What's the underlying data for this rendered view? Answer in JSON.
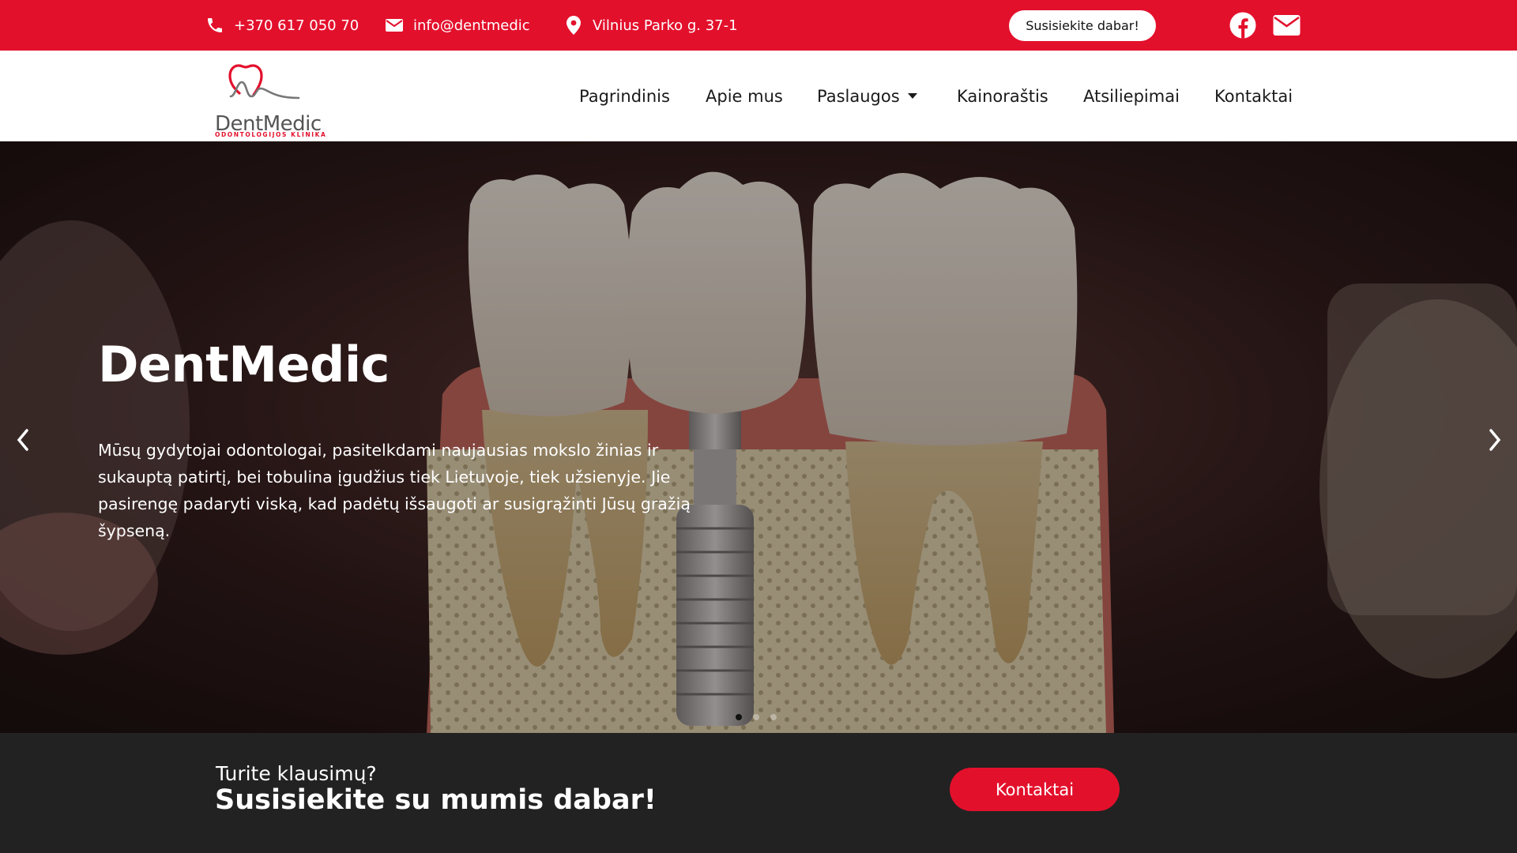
{
  "topbar": {
    "phone": "+370 617 050 70",
    "email": "info@dentmedic",
    "address": "Vilnius Parko g. 37-1",
    "cta_label": "Susisiekite dabar!",
    "icons": [
      "phone-icon",
      "mail-icon",
      "location-pin-icon",
      "facebook-icon",
      "envelope-icon"
    ],
    "background_color": "#e3102c"
  },
  "logo": {
    "wordmark": "DentMedic",
    "tagline": "ODONTOLOGIJOS KLINIKA",
    "accent_color": "#e3102c"
  },
  "nav": {
    "items": [
      {
        "label": "Pagrindinis"
      },
      {
        "label": "Apie mus"
      },
      {
        "label": "Paslaugos",
        "has_dropdown": true
      },
      {
        "label": "Kainoraštis"
      },
      {
        "label": "Atsiliepimai"
      },
      {
        "label": "Kontaktai"
      }
    ]
  },
  "hero": {
    "title": "DentMedic",
    "text": "Mūsų gydytojai odontologai, pasitelkdami naujausias mokslo žinias ir sukauptą patirtį, bei tobulina įgudžius tiek Lietuvoje, tiek užsienyje. Jie pasirengę padaryti viską, kad padėtų išsaugoti ar susigrąžinti Jūsų gražią šypseną.",
    "slides_count": 3,
    "active_slide": 1,
    "icons": [
      "chevron-left-icon",
      "chevron-right-icon"
    ]
  },
  "contact_strip": {
    "question": "Turite klausimų?",
    "heading": "Susisiekite su mumis dabar!",
    "button_label": "Kontaktai",
    "background_color": "#222222"
  }
}
